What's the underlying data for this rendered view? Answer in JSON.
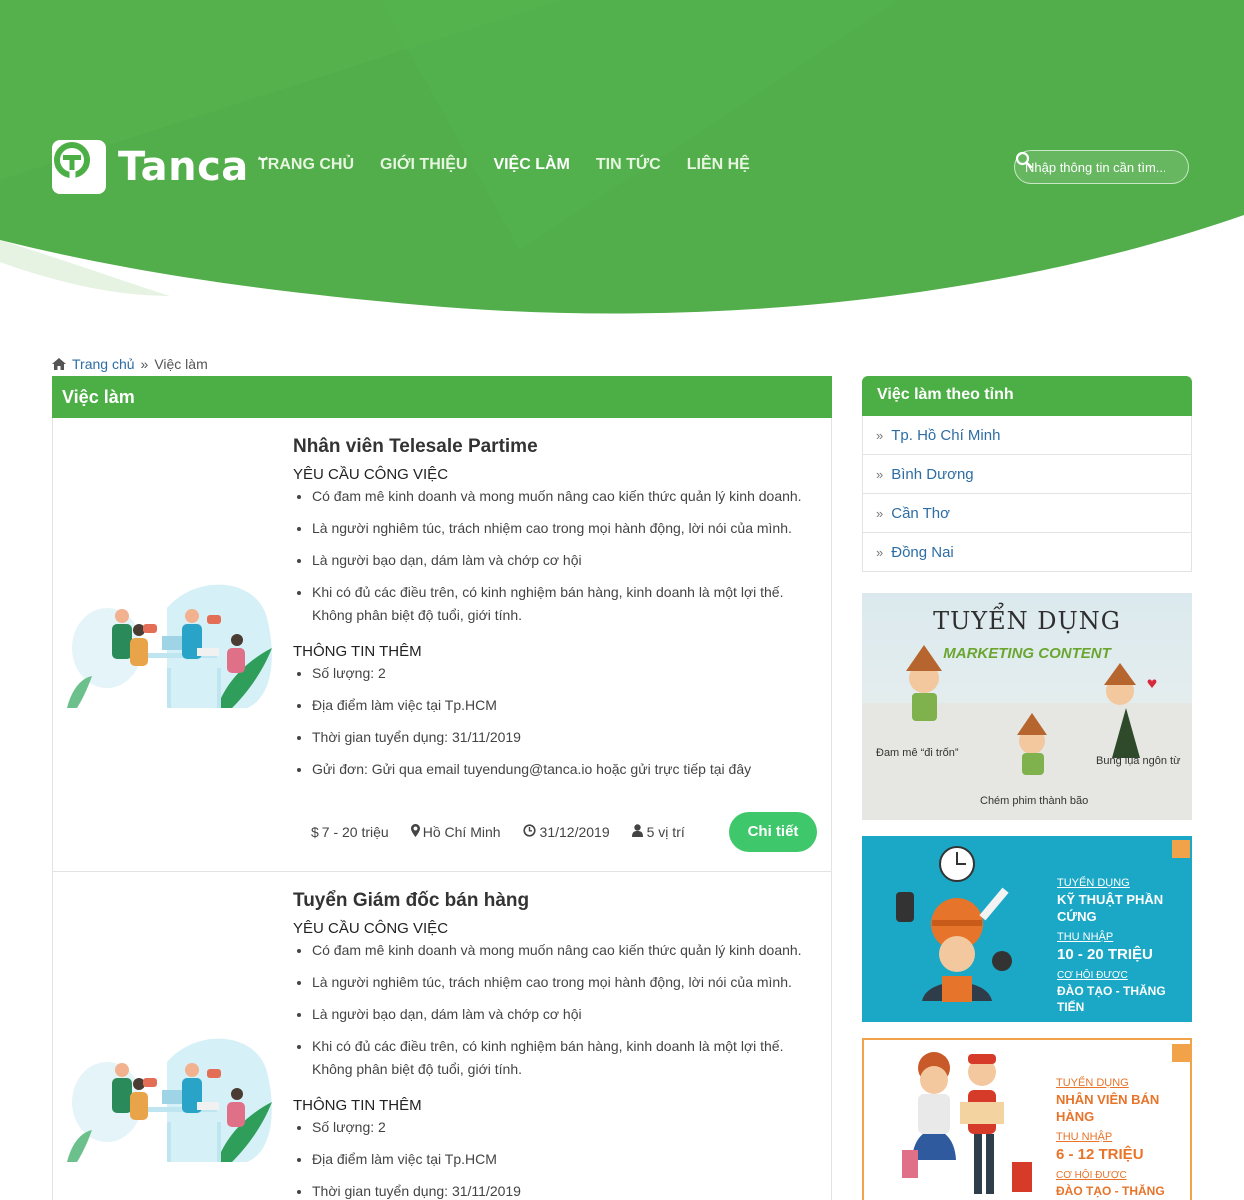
{
  "header": {
    "brand": "Tanca",
    "nav": [
      "TRANG CHỦ",
      "GIỚI THIỆU",
      "VIỆC LÀM",
      "TIN TỨC",
      "LIÊN HỆ"
    ],
    "search_placeholder": "Nhập thông tin cần tìm..."
  },
  "breadcrumb": {
    "home": "Trang chủ",
    "sep": "»",
    "current": "Việc làm"
  },
  "main": {
    "title": "Việc làm"
  },
  "jobs": [
    {
      "title": "Nhân viên Telesale Partime",
      "req_title": "YÊU CẦU CÔNG VIỆC",
      "reqs": [
        "Có đam mê kinh doanh và mong muốn nâng cao kiến thức quản lý kinh doanh.",
        "Là người nghiêm túc, trách nhiệm cao trong mọi hành động, lời nói của mình.",
        "Là người bạo dạn, dám làm và chớp cơ hội",
        "Khi có đủ các điều trên, có kinh nghiệm bán hàng, kinh doanh là một lợi thế. Không phân biệt độ tuổi, giới tính."
      ],
      "info_title": "THÔNG TIN THÊM",
      "infos": [
        "Số lượng: 2",
        "Địa điểm làm việc tại Tp.HCM",
        "Thời gian tuyển dụng: 31/11/2019",
        "Gửi đơn: Gửi qua email tuyendung@tanca.io hoặc gửi trực tiếp tại đây"
      ],
      "salary": "7 - 20 triệu",
      "location": "Hồ Chí Minh",
      "deadline": "31/12/2019",
      "positions": "5 vị trí",
      "button": "Chi tiết"
    },
    {
      "title": "Tuyển Giám đốc bán hàng",
      "req_title": "YÊU CẦU CÔNG VIỆC",
      "reqs": [
        "Có đam mê kinh doanh và mong muốn nâng cao kiến thức quản lý kinh doanh.",
        "Là người nghiêm túc, trách nhiệm cao trong mọi hành động, lời nói của mình.",
        "Là người bạo dạn, dám làm và chớp cơ hội",
        "Khi có đủ các điều trên, có kinh nghiệm bán hàng, kinh doanh là một lợi thế. Không phân biệt độ tuổi, giới tính."
      ],
      "info_title": "THÔNG TIN THÊM",
      "infos": [
        "Số lượng: 2",
        "Địa điểm làm việc tại Tp.HCM",
        "Thời gian tuyển dụng: 31/11/2019"
      ]
    }
  ],
  "sidebar": {
    "title": "Việc làm theo tỉnh",
    "provinces": [
      "Tp. Hồ Chí Minh",
      "Bình Dương",
      "Cần Thơ",
      "Đồng Nai"
    ]
  },
  "banners": [
    {
      "title": "TUYỂN DỤNG",
      "subtitle": "MARKETING CONTENT",
      "captions": [
        "Đam mê “đi trốn”",
        "Bung lụa ngôn từ",
        "Chém phim thành bão"
      ]
    },
    {
      "l1": "TUYỂN DỤNG",
      "l2": "KỸ THUẬT PHẦN CỨNG",
      "l3": "THU NHẬP",
      "l4": "10 - 20 TRIỆU",
      "l5": "CƠ HỘI ĐƯỢC",
      "l6": "ĐÀO TẠO - THĂNG TIẾN"
    },
    {
      "l1": "TUYỂN DỤNG",
      "l2": "NHÂN VIÊN BÁN HÀNG",
      "l3": "THU NHẬP",
      "l4": "6 - 12 TRIỆU",
      "l5": "CƠ HỘI ĐƯỢC",
      "l6": "ĐÀO TẠO - THĂNG TIẾN"
    }
  ],
  "colors": {
    "brand_green": "#4caf45",
    "button_green": "#3ec86b",
    "link_blue": "#2d6da3"
  }
}
